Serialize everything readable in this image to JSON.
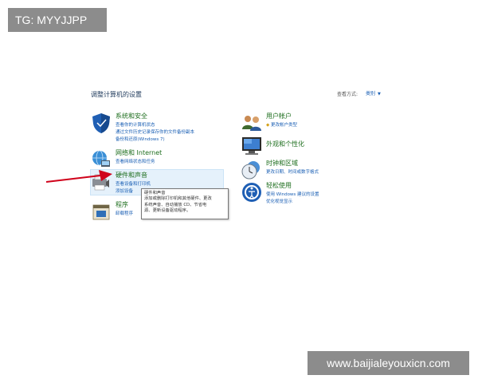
{
  "overlay": {
    "top_label": "TG: MYYJJPP",
    "watermark": "www.baijialeyouxicn.com"
  },
  "header": {
    "title": "调整计算机的设置",
    "view_by_label": "查看方式:",
    "view_by_value": "类别"
  },
  "categories_left": [
    {
      "title": "系统和安全",
      "icon": "shield-icon",
      "links": [
        "查看你的计算机状态",
        "通过文件历史记录保存你的文件备份副本",
        "备份和还原(Windows 7)"
      ]
    },
    {
      "title": "网络和 Internet",
      "icon": "network-globe-icon",
      "links": [
        "查看网络状态和任务"
      ]
    },
    {
      "title": "硬件和声音",
      "icon": "printer-speaker-icon",
      "links": [
        "查看设备和打印机",
        "添加设备"
      ]
    },
    {
      "title": "程序",
      "icon": "programs-icon",
      "links": [
        "卸载程序"
      ]
    }
  ],
  "categories_right": [
    {
      "title": "用户帐户",
      "icon": "users-icon",
      "links": [
        "更改帐户类型"
      ]
    },
    {
      "title": "外观和个性化",
      "icon": "appearance-icon",
      "links": []
    },
    {
      "title": "时钟和区域",
      "icon": "clock-icon",
      "links": [
        "更改日期、时间或数字格式"
      ]
    },
    {
      "title": "轻松使用",
      "icon": "ease-of-access-icon",
      "links": [
        "使用 Windows 建议的设置",
        "优化视觉显示"
      ]
    }
  ],
  "tooltip": {
    "lines": [
      "硬件和声音",
      "添加或删除打印机和其他硬件、更改",
      "系统声音、自动播放 CD、节省电",
      "源、更新设备驱动程序。"
    ]
  },
  "colors": {
    "category_title": "#1e6e1e",
    "link": "#1a5fb4",
    "arrow": "#d0021b",
    "hover": "#e5f1fb"
  }
}
